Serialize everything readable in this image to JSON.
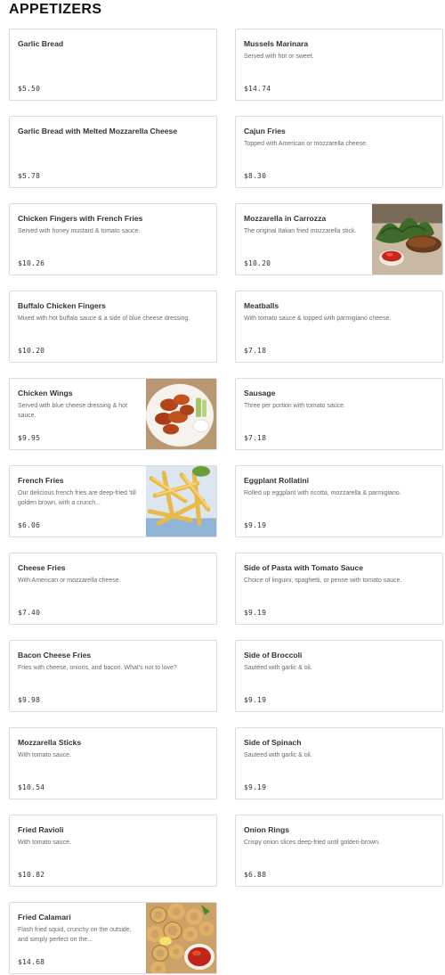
{
  "section": {
    "title": "APPETIZERS"
  },
  "items": [
    {
      "name": "Garlic Bread",
      "desc": "",
      "price": "$5.50"
    },
    {
      "name": "Mussels Marinara",
      "desc": "Served with hot or sweet.",
      "price": "$14.74"
    },
    {
      "name": "Garlic Bread with Melted Mozzarella Cheese",
      "desc": "",
      "price": "$5.78"
    },
    {
      "name": "Cajun Fries",
      "desc": "Topped with American or mozzarella cheese.",
      "price": "$8.30"
    },
    {
      "name": "Chicken Fingers with French Fries",
      "desc": "Served with honey mustard & tomato sauce.",
      "price": "$10.26"
    },
    {
      "name": "Mozzarella in Carrozza",
      "desc": "The original Italian fried mozzarella stick.",
      "price": "$10.20",
      "image": "fried-mozzarella-photo"
    },
    {
      "name": "Buffalo Chicken Fingers",
      "desc": "Mixed with hot buffalo sauce & a side of blue cheese dressing.",
      "price": "$10.20"
    },
    {
      "name": "Meatballs",
      "desc": "With tomato sauce & topped with parmigiano cheese.",
      "price": "$7.18"
    },
    {
      "name": "Chicken Wings",
      "desc": "Served with blue cheese dressing & hot sauce.",
      "price": "$9.95",
      "image": "chicken-wings-photo"
    },
    {
      "name": "Sausage",
      "desc": "Three per portion with tomato sauce.",
      "price": "$7.18"
    },
    {
      "name": "French Fries",
      "desc": "Our delicious french fries are deep-fried 'till golden brown, with a crunch...",
      "price": "$6.06",
      "image": "french-fries-photo"
    },
    {
      "name": "Eggplant Rollatini",
      "desc": "Rolled up eggplant with ricotta, mozzarella & parmigiano.",
      "price": "$9.19"
    },
    {
      "name": "Cheese Fries",
      "desc": "With American or mozzarella cheese.",
      "price": "$7.40"
    },
    {
      "name": "Side of Pasta with Tomato Sauce",
      "desc": "Choice of linguini, spaghetti, or penne with tomato sauce.",
      "price": "$9.19"
    },
    {
      "name": "Bacon Cheese Fries",
      "desc": "Fries with cheese, onions, and bacon. What's not to love?",
      "price": "$9.98"
    },
    {
      "name": "Side of Broccoli",
      "desc": "Sautéed with garlic & oil.",
      "price": "$9.19"
    },
    {
      "name": "Mozzarella Sticks",
      "desc": "With tomato sauce.",
      "price": "$10.54"
    },
    {
      "name": "Side of Spinach",
      "desc": "Sauteed with garlic & oil.",
      "price": "$9.19"
    },
    {
      "name": "Fried Ravioli",
      "desc": "With tomato sauce.",
      "price": "$10.82"
    },
    {
      "name": "Onion Rings",
      "desc": "Crispy onion slices deep-fried until golden-brown.",
      "price": "$6.88"
    },
    {
      "name": "Fried Calamari",
      "desc": "Flash fried squid, crunchy on the outside, and simply perfect on the...",
      "price": "$14.68",
      "image": "fried-calamari-photo"
    }
  ]
}
